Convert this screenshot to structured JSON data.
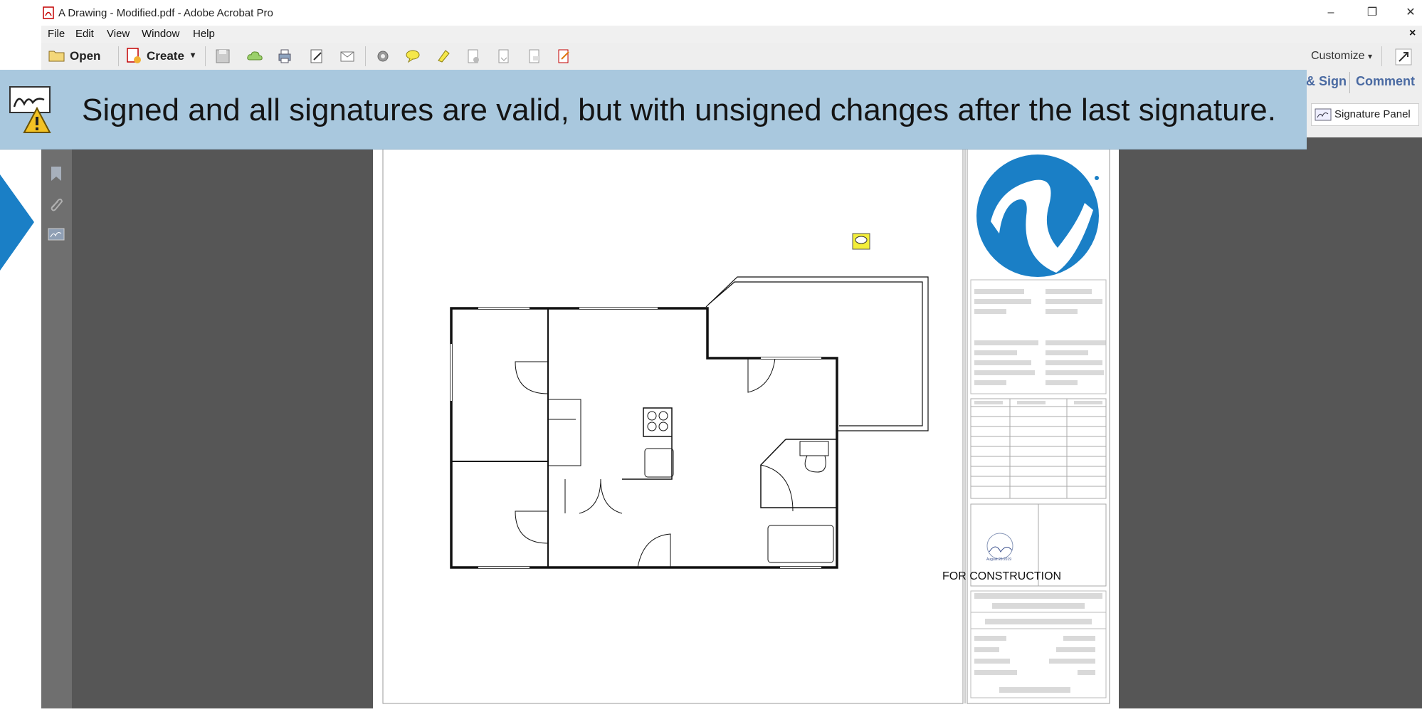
{
  "window": {
    "title": "A Drawing - Modified.pdf - Adobe Acrobat Pro",
    "minimize": "–",
    "maximize": "❐",
    "close": "✕",
    "menu_close": "×"
  },
  "menu": [
    "File",
    "Edit",
    "View",
    "Window",
    "Help"
  ],
  "toolbar": {
    "open_label": "Open",
    "create_label": "Create",
    "customize_label": "Customize"
  },
  "right_panel": {
    "sign_tab": "& Sign",
    "comment_tab": "Comment",
    "signature_panel_label": "Signature Panel"
  },
  "banner": {
    "message": "Signed and all signatures are valid, but with unsigned changes after the last signature."
  },
  "drawing": {
    "stamp_note": "FOR CONSTRUCTION",
    "seal_date": "August 25 2019"
  },
  "colors": {
    "banner_bg": "#a9c8de",
    "accent_blue": "#1a7fc6",
    "workspace": "#565656"
  }
}
